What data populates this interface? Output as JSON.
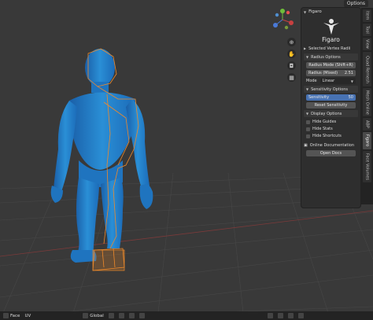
{
  "topbar": {
    "options_label": "Options"
  },
  "panel": {
    "header_title": "Figaro",
    "brand": "Figaro",
    "selected_vertex_radii": "Selected Vertex Radii",
    "radius_options_title": "Radius Options",
    "radius_mode_button": "Radius Mode (Shift+R)",
    "radius_field_label": "Radius (Mixed)",
    "radius_field_value": "2.51",
    "mode_label": "Mode",
    "mode_value": "Linear",
    "sensitivity_options_title": "Sensitivity Options",
    "sensitivity_label": "Sensitivity",
    "sensitivity_value": "50",
    "reset_sensitivity_button": "Reset Sensitivity",
    "display_options_title": "Display Options",
    "hide_guides": "Hide Guides",
    "hide_stats": "Hide Stats",
    "hide_shortcuts": "Hide Shortcuts",
    "online_documentation": "Online Documentation",
    "open_docs_button": "Open Docs"
  },
  "tabs": [
    "Item",
    "Tool",
    "View",
    "Quad Remesh",
    "Mesh Online",
    "ABP",
    "Figaro",
    "Face Volumes"
  ],
  "bottombar": {
    "face_label": "Face",
    "uv_label": "UV",
    "transform_label": "Global"
  },
  "colors": {
    "accent": "#4772b3",
    "mesh": "#2a8fd6",
    "wire": "#f08a2a",
    "grid": "#4f4f4f"
  }
}
